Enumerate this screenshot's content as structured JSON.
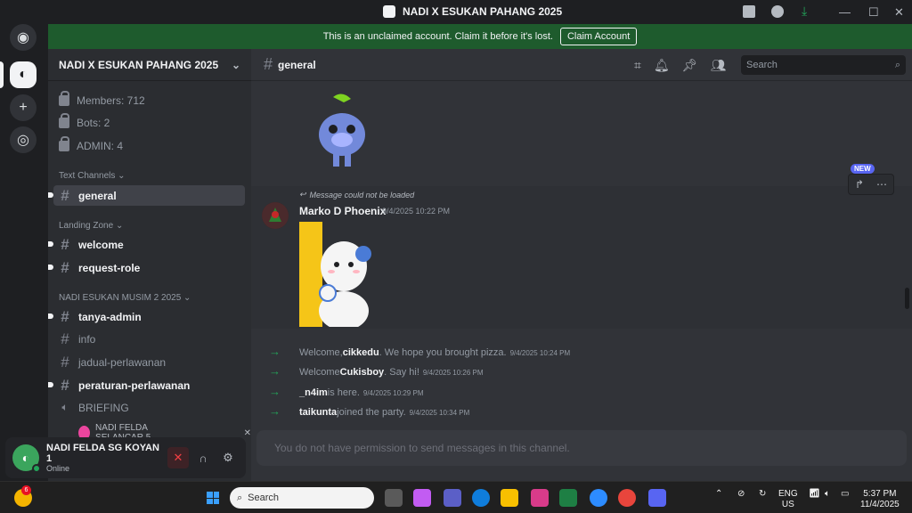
{
  "window": {
    "title": "NADI X ESUKAN PAHANG 2025",
    "controls": [
      "minimize",
      "maximize",
      "close"
    ]
  },
  "banner": {
    "text": "This is an unclaimed account. Claim it before it's lost.",
    "button": "Claim Account"
  },
  "guild": {
    "name": "NADI X ESUKAN PAHANG 2025",
    "stats": [
      {
        "label": "Members: 712"
      },
      {
        "label": "Bots: 2"
      },
      {
        "label": "ADMIN: 4"
      }
    ],
    "categories": [
      {
        "label": "Text Channels"
      },
      {
        "label": "Landing Zone"
      },
      {
        "label": "NADI ESUKAN MUSIM 2 2025"
      }
    ],
    "channels": [
      {
        "name": "general"
      },
      {
        "name": "welcome"
      },
      {
        "name": "request-role"
      },
      {
        "name": "tanya-admin"
      },
      {
        "name": "info"
      },
      {
        "name": "jadual-perlawanan"
      },
      {
        "name": "peraturan-perlawanan"
      },
      {
        "name": "BRIEFING"
      }
    ],
    "voice_user": "NADI FELDA SELANCAR 5"
  },
  "user_panel": {
    "name": "NADI FELDA SG KOYAN 1",
    "status": "Online"
  },
  "channel_header": {
    "name": "general",
    "search_placeholder": "Search"
  },
  "message": {
    "reply_text": "Message could not be loaded",
    "author": "Marko D Phoenix",
    "time": "9/4/2025 10:22 PM",
    "new_badge": "NEW"
  },
  "joins": [
    {
      "pre": "Welcome, ",
      "name": "cikkedu",
      "post": ". We hope you brought pizza.",
      "time": "9/4/2025 10:24 PM"
    },
    {
      "pre": "Welcome ",
      "name": "Cukisboy",
      "post": ". Say hi!",
      "time": "9/4/2025 10:26 PM"
    },
    {
      "pre": "",
      "name": "_n4im",
      "post": " is here.",
      "time": "9/4/2025 10:29 PM"
    },
    {
      "pre": "",
      "name": "taikunta",
      "post": " joined the party.",
      "time": "9/4/2025 10:34 PM"
    }
  ],
  "composer": {
    "placeholder": "You do not have permission to send messages in this channel."
  },
  "taskbar": {
    "weather_badge": "6",
    "search_placeholder": "Search",
    "lang_top": "ENG",
    "lang_bottom": "US",
    "clock_time": "5:37 PM",
    "clock_date": "11/4/2025"
  }
}
